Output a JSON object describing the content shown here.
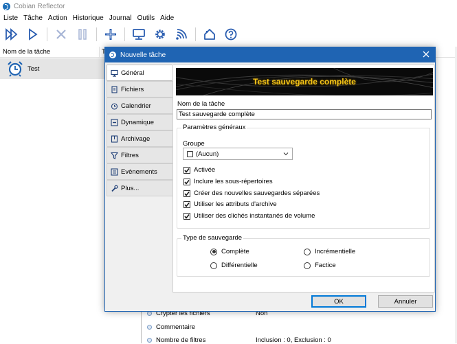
{
  "window": {
    "title": "Cobian Reflector"
  },
  "menu": [
    "Liste",
    "Tâche",
    "Action",
    "Historique",
    "Journal",
    "Outils",
    "Aide"
  ],
  "toolbar": {
    "icons": [
      "run-all-icon",
      "run-icon",
      "stop-icon",
      "pause-icon",
      "add-task-icon",
      "monitor-icon",
      "settings-icon",
      "network-icon",
      "home-icon",
      "help-icon"
    ],
    "accent": "#1c6fb8"
  },
  "task_list": {
    "header": {
      "name_col": "Nom de la tâche",
      "second_col": "T"
    },
    "rows": [
      {
        "name": "Test"
      }
    ]
  },
  "properties": [
    {
      "label": "Crypter les fichiers",
      "value": "Non"
    },
    {
      "label": "Commentaire",
      "value": ""
    },
    {
      "label": "Nombre de filtres",
      "value": "Inclusion : 0, Exclusion : 0"
    }
  ],
  "dialog": {
    "title": "Nouvelle tâche",
    "tabs": [
      "Général",
      "Fichiers",
      "Calendrier",
      "Dynamique",
      "Archivage",
      "Filtres",
      "Evènements",
      "Plus..."
    ],
    "active_tab": "Général",
    "banner_text": "Test sauvegarde complète",
    "name_label": "Nom de la tâche",
    "name_value": "Test sauvegarde complète",
    "general_params": {
      "legend": "Paramètres généraux",
      "group_label": "Groupe",
      "group_value": "(Aucun)",
      "checkboxes": [
        {
          "label": "Activée",
          "checked": true
        },
        {
          "label": "Inclure les sous-répertoires",
          "checked": true
        },
        {
          "label": "Créer des nouvelles sauvegardes séparées",
          "checked": true
        },
        {
          "label": "Utiliser les attributs d'archive",
          "checked": true
        },
        {
          "label": "Utiliser des clichés instantanés de volume",
          "checked": true
        }
      ]
    },
    "backup_type": {
      "legend": "Type de sauvegarde",
      "options": [
        "Complète",
        "Incrémentielle",
        "Différentielle",
        "Factice"
      ],
      "selected": "Complète"
    },
    "ok_label": "OK",
    "cancel_label": "Annuler"
  }
}
